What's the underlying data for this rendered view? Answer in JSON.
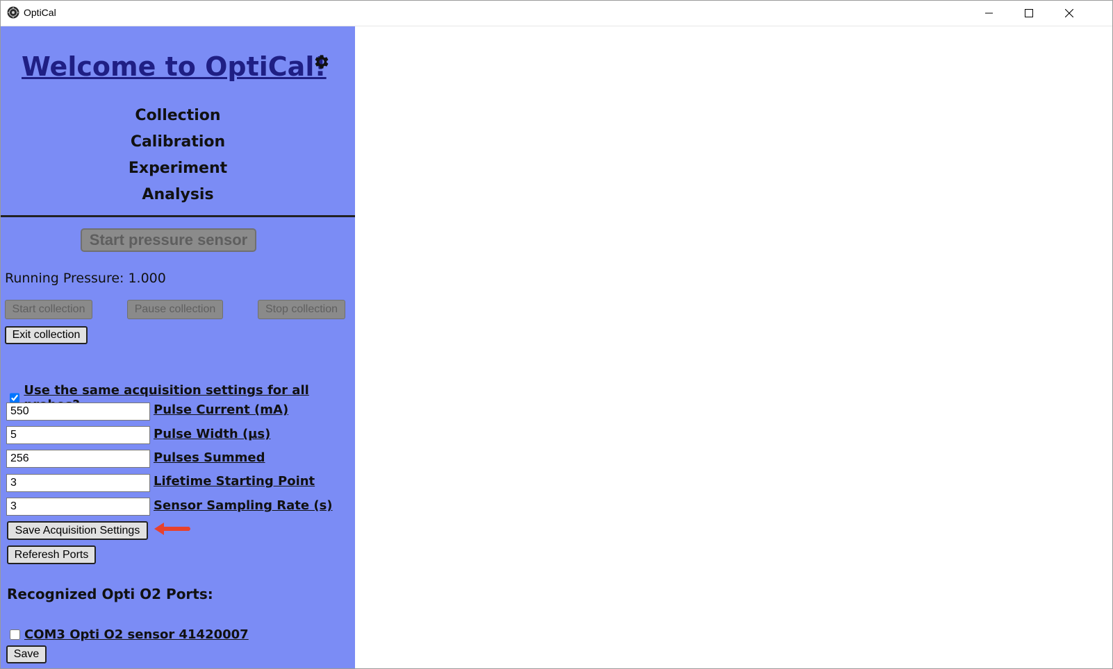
{
  "window": {
    "title": "OptiCal",
    "controls": [
      "minimize",
      "maximize",
      "close"
    ]
  },
  "header": {
    "welcome": "Welcome to OptiCal!",
    "settings_icon": "gear-icon"
  },
  "nav": {
    "items": [
      {
        "label": "Collection"
      },
      {
        "label": "Calibration"
      },
      {
        "label": "Experiment"
      },
      {
        "label": "Analysis"
      }
    ]
  },
  "pressure": {
    "start_button": "Start pressure sensor",
    "running_text": "Running Pressure: 1.000"
  },
  "collection": {
    "start": "Start collection",
    "pause": "Pause collection",
    "stop": "Stop collection",
    "exit": "Exit collection"
  },
  "acquisition": {
    "same_settings_label": "Use the same acquisition settings for all probes?",
    "same_settings_checked": true,
    "fields": [
      {
        "value": "550",
        "label": " Pulse Current (mA)"
      },
      {
        "value": "5",
        "label": " Pulse Width (µs)"
      },
      {
        "value": "256",
        "label": " Pulses Summed"
      },
      {
        "value": "3",
        "label": " Lifetime Starting Point"
      },
      {
        "value": "3",
        "label": " Sensor Sampling Rate (s)"
      }
    ],
    "save_button": "Save Acquisition Settings",
    "refresh_button": "Referesh Ports"
  },
  "ports": {
    "title": "Recognized Opti O2 Ports:",
    "items": [
      {
        "label": "COM3 Opti O2 sensor 41420007",
        "checked": false
      }
    ],
    "save_button": "Save"
  },
  "colors": {
    "sidebar_bg": "#7b8cf5",
    "welcome_text": "#1f1f84",
    "annotation_arrow": "#e8412c"
  }
}
